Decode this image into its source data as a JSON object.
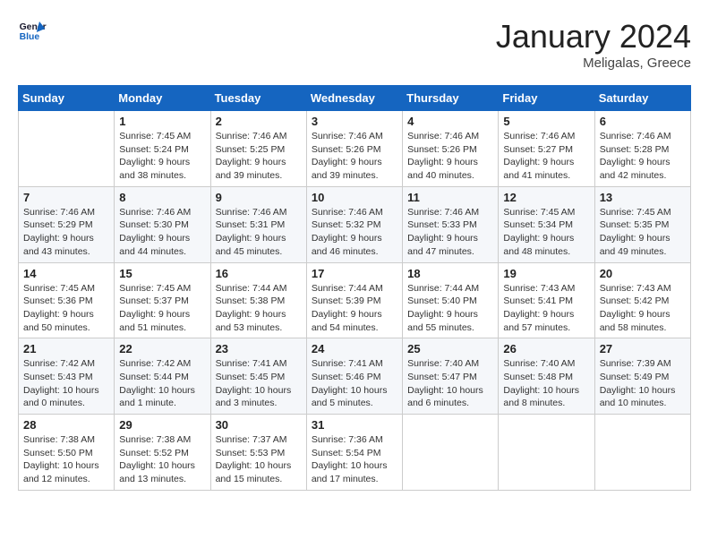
{
  "logo": {
    "line1": "General",
    "line2": "Blue"
  },
  "title": "January 2024",
  "location": "Meligalas, Greece",
  "days_header": [
    "Sunday",
    "Monday",
    "Tuesday",
    "Wednesday",
    "Thursday",
    "Friday",
    "Saturday"
  ],
  "weeks": [
    [
      {
        "day": "",
        "sunrise": "",
        "sunset": "",
        "daylight": ""
      },
      {
        "day": "1",
        "sunrise": "7:45 AM",
        "sunset": "5:24 PM",
        "daylight": "9 hours and 38 minutes."
      },
      {
        "day": "2",
        "sunrise": "7:46 AM",
        "sunset": "5:25 PM",
        "daylight": "9 hours and 39 minutes."
      },
      {
        "day": "3",
        "sunrise": "7:46 AM",
        "sunset": "5:26 PM",
        "daylight": "9 hours and 39 minutes."
      },
      {
        "day": "4",
        "sunrise": "7:46 AM",
        "sunset": "5:26 PM",
        "daylight": "9 hours and 40 minutes."
      },
      {
        "day": "5",
        "sunrise": "7:46 AM",
        "sunset": "5:27 PM",
        "daylight": "9 hours and 41 minutes."
      },
      {
        "day": "6",
        "sunrise": "7:46 AM",
        "sunset": "5:28 PM",
        "daylight": "9 hours and 42 minutes."
      }
    ],
    [
      {
        "day": "7",
        "sunrise": "7:46 AM",
        "sunset": "5:29 PM",
        "daylight": "9 hours and 43 minutes."
      },
      {
        "day": "8",
        "sunrise": "7:46 AM",
        "sunset": "5:30 PM",
        "daylight": "9 hours and 44 minutes."
      },
      {
        "day": "9",
        "sunrise": "7:46 AM",
        "sunset": "5:31 PM",
        "daylight": "9 hours and 45 minutes."
      },
      {
        "day": "10",
        "sunrise": "7:46 AM",
        "sunset": "5:32 PM",
        "daylight": "9 hours and 46 minutes."
      },
      {
        "day": "11",
        "sunrise": "7:46 AM",
        "sunset": "5:33 PM",
        "daylight": "9 hours and 47 minutes."
      },
      {
        "day": "12",
        "sunrise": "7:45 AM",
        "sunset": "5:34 PM",
        "daylight": "9 hours and 48 minutes."
      },
      {
        "day": "13",
        "sunrise": "7:45 AM",
        "sunset": "5:35 PM",
        "daylight": "9 hours and 49 minutes."
      }
    ],
    [
      {
        "day": "14",
        "sunrise": "7:45 AM",
        "sunset": "5:36 PM",
        "daylight": "9 hours and 50 minutes."
      },
      {
        "day": "15",
        "sunrise": "7:45 AM",
        "sunset": "5:37 PM",
        "daylight": "9 hours and 51 minutes."
      },
      {
        "day": "16",
        "sunrise": "7:44 AM",
        "sunset": "5:38 PM",
        "daylight": "9 hours and 53 minutes."
      },
      {
        "day": "17",
        "sunrise": "7:44 AM",
        "sunset": "5:39 PM",
        "daylight": "9 hours and 54 minutes."
      },
      {
        "day": "18",
        "sunrise": "7:44 AM",
        "sunset": "5:40 PM",
        "daylight": "9 hours and 55 minutes."
      },
      {
        "day": "19",
        "sunrise": "7:43 AM",
        "sunset": "5:41 PM",
        "daylight": "9 hours and 57 minutes."
      },
      {
        "day": "20",
        "sunrise": "7:43 AM",
        "sunset": "5:42 PM",
        "daylight": "9 hours and 58 minutes."
      }
    ],
    [
      {
        "day": "21",
        "sunrise": "7:42 AM",
        "sunset": "5:43 PM",
        "daylight": "10 hours and 0 minutes."
      },
      {
        "day": "22",
        "sunrise": "7:42 AM",
        "sunset": "5:44 PM",
        "daylight": "10 hours and 1 minute."
      },
      {
        "day": "23",
        "sunrise": "7:41 AM",
        "sunset": "5:45 PM",
        "daylight": "10 hours and 3 minutes."
      },
      {
        "day": "24",
        "sunrise": "7:41 AM",
        "sunset": "5:46 PM",
        "daylight": "10 hours and 5 minutes."
      },
      {
        "day": "25",
        "sunrise": "7:40 AM",
        "sunset": "5:47 PM",
        "daylight": "10 hours and 6 minutes."
      },
      {
        "day": "26",
        "sunrise": "7:40 AM",
        "sunset": "5:48 PM",
        "daylight": "10 hours and 8 minutes."
      },
      {
        "day": "27",
        "sunrise": "7:39 AM",
        "sunset": "5:49 PM",
        "daylight": "10 hours and 10 minutes."
      }
    ],
    [
      {
        "day": "28",
        "sunrise": "7:38 AM",
        "sunset": "5:50 PM",
        "daylight": "10 hours and 12 minutes."
      },
      {
        "day": "29",
        "sunrise": "7:38 AM",
        "sunset": "5:52 PM",
        "daylight": "10 hours and 13 minutes."
      },
      {
        "day": "30",
        "sunrise": "7:37 AM",
        "sunset": "5:53 PM",
        "daylight": "10 hours and 15 minutes."
      },
      {
        "day": "31",
        "sunrise": "7:36 AM",
        "sunset": "5:54 PM",
        "daylight": "10 hours and 17 minutes."
      },
      {
        "day": "",
        "sunrise": "",
        "sunset": "",
        "daylight": ""
      },
      {
        "day": "",
        "sunrise": "",
        "sunset": "",
        "daylight": ""
      },
      {
        "day": "",
        "sunrise": "",
        "sunset": "",
        "daylight": ""
      }
    ]
  ],
  "labels": {
    "sunrise_prefix": "Sunrise: ",
    "sunset_prefix": "Sunset: ",
    "daylight_prefix": "Daylight: "
  }
}
